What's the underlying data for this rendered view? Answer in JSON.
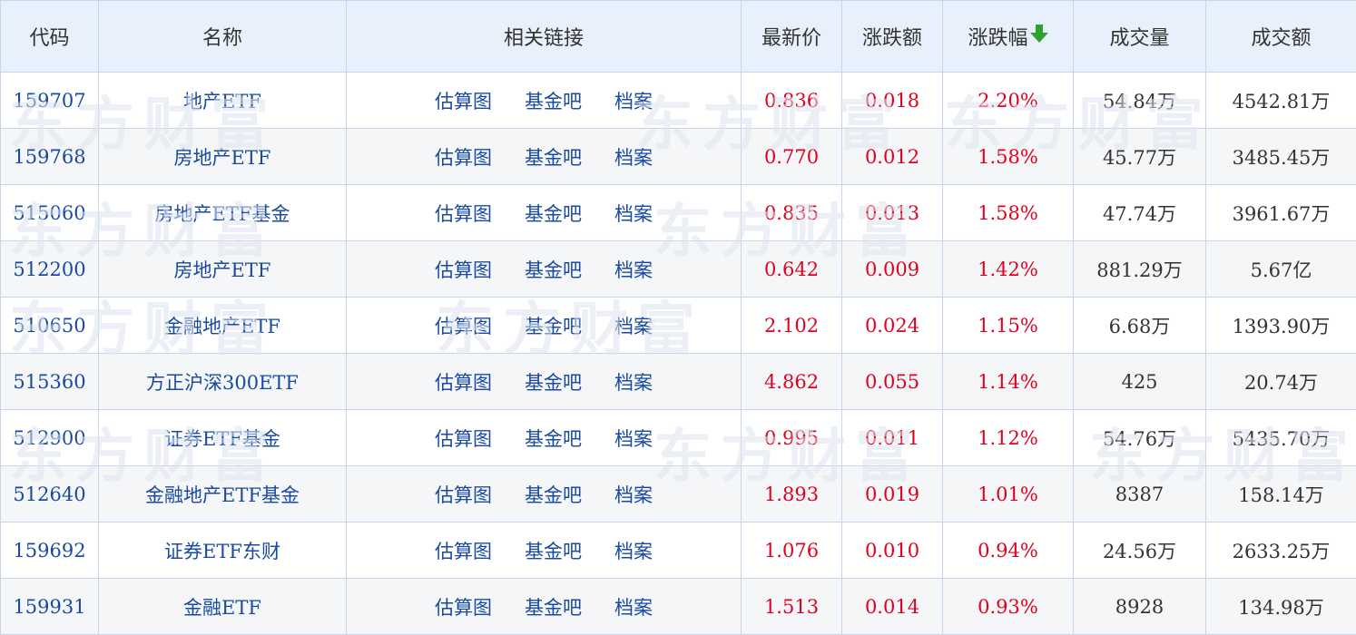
{
  "columns": {
    "code": "代码",
    "name": "名称",
    "links": "相关链接",
    "price": "最新价",
    "change": "涨跌额",
    "change_pct": "涨跌幅",
    "volume": "成交量",
    "amount": "成交额"
  },
  "sort_icon": "arrow-down-icon",
  "colors": {
    "up": "#e0001f",
    "link": "#1a4aa0",
    "header_bg": "#e7f0fb",
    "sort_arrow": "#2fa12f"
  },
  "watermark_text": "东方财富",
  "rows": [
    {
      "code": "159707",
      "name": "地产ETF",
      "links": [
        "估算图",
        "基金吧",
        "档案"
      ],
      "price": "0.836",
      "change": "0.018",
      "change_pct": "2.20%",
      "volume": "54.84万",
      "amount": "4542.81万"
    },
    {
      "code": "159768",
      "name": "房地产ETF",
      "links": [
        "估算图",
        "基金吧",
        "档案"
      ],
      "price": "0.770",
      "change": "0.012",
      "change_pct": "1.58%",
      "volume": "45.77万",
      "amount": "3485.45万"
    },
    {
      "code": "515060",
      "name": "房地产ETF基金",
      "links": [
        "估算图",
        "基金吧",
        "档案"
      ],
      "price": "0.835",
      "change": "0.013",
      "change_pct": "1.58%",
      "volume": "47.74万",
      "amount": "3961.67万"
    },
    {
      "code": "512200",
      "name": "房地产ETF",
      "links": [
        "估算图",
        "基金吧",
        "档案"
      ],
      "price": "0.642",
      "change": "0.009",
      "change_pct": "1.42%",
      "volume": "881.29万",
      "amount": "5.67亿"
    },
    {
      "code": "510650",
      "name": "金融地产ETF",
      "links": [
        "估算图",
        "基金吧",
        "档案"
      ],
      "price": "2.102",
      "change": "0.024",
      "change_pct": "1.15%",
      "volume": "6.68万",
      "amount": "1393.90万"
    },
    {
      "code": "515360",
      "name": "方正沪深300ETF",
      "links": [
        "估算图",
        "基金吧",
        "档案"
      ],
      "price": "4.862",
      "change": "0.055",
      "change_pct": "1.14%",
      "volume": "425",
      "amount": "20.74万"
    },
    {
      "code": "512900",
      "name": "证券ETF基金",
      "links": [
        "估算图",
        "基金吧",
        "档案"
      ],
      "price": "0.995",
      "change": "0.011",
      "change_pct": "1.12%",
      "volume": "54.76万",
      "amount": "5435.70万"
    },
    {
      "code": "512640",
      "name": "金融地产ETF基金",
      "links": [
        "估算图",
        "基金吧",
        "档案"
      ],
      "price": "1.893",
      "change": "0.019",
      "change_pct": "1.01%",
      "volume": "8387",
      "amount": "158.14万"
    },
    {
      "code": "159692",
      "name": "证券ETF东财",
      "links": [
        "估算图",
        "基金吧",
        "档案"
      ],
      "price": "1.076",
      "change": "0.010",
      "change_pct": "0.94%",
      "volume": "24.56万",
      "amount": "2633.25万"
    },
    {
      "code": "159931",
      "name": "金融ETF",
      "links": [
        "估算图",
        "基金吧",
        "档案"
      ],
      "price": "1.513",
      "change": "0.014",
      "change_pct": "0.93%",
      "volume": "8928",
      "amount": "134.98万"
    }
  ]
}
